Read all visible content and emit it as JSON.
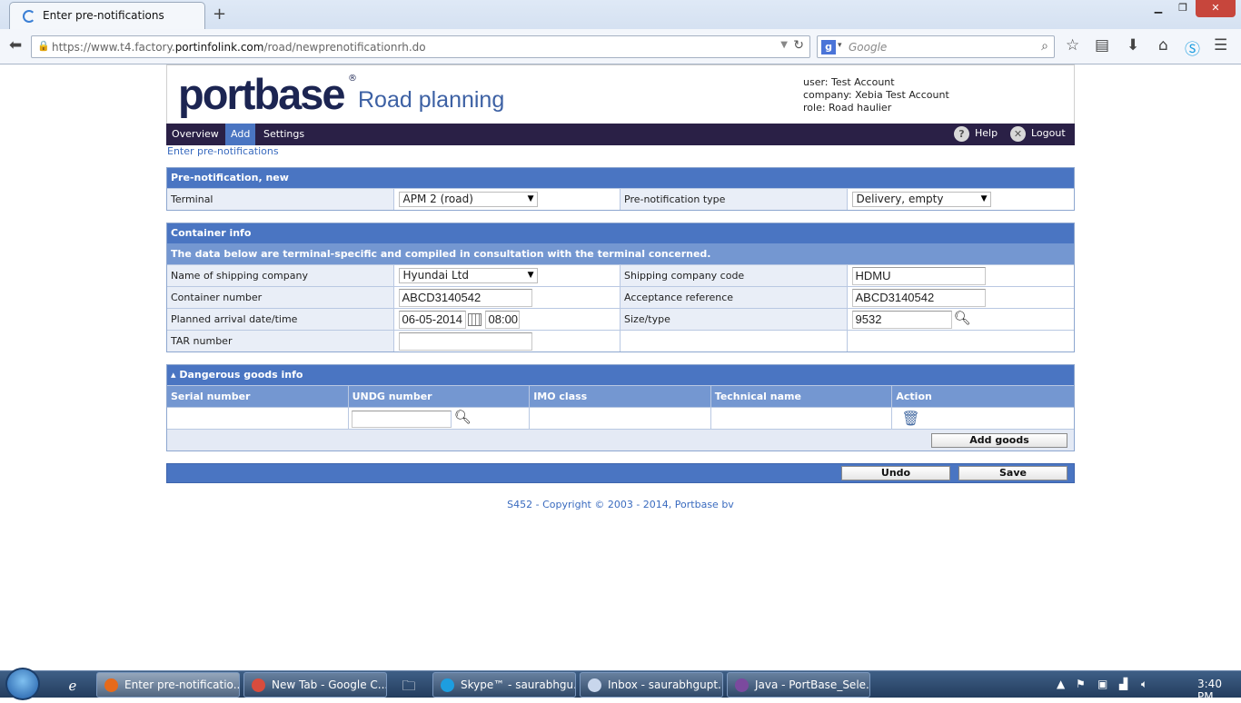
{
  "browser": {
    "tab_title": "Enter pre-notifications",
    "new_tab": "+",
    "url_prefix": "https://www.t4.factory.",
    "url_domain": "portinfolink.com",
    "url_path": "/road/newprenotificationrh.do",
    "search_placeholder": "Google",
    "window_min": "▁",
    "window_max": "❐",
    "window_close": "✕"
  },
  "header": {
    "logo": "portbase",
    "logo_mark": "®",
    "subtitle": "Road planning",
    "user_line": "user: Test Account",
    "company_line": "company: Xebia Test Account",
    "role_line": "role: Road haulier"
  },
  "menu": {
    "items": [
      {
        "label": "Overview",
        "active": false
      },
      {
        "label": "Add",
        "active": true
      },
      {
        "label": "Settings",
        "active": false
      }
    ],
    "help": "Help",
    "logout": "Logout"
  },
  "breadcrumb": "Enter pre-notifications",
  "prenotification": {
    "title": "Pre-notification, new",
    "terminal_label": "Terminal",
    "terminal_value": "APM 2 (road)",
    "type_label": "Pre-notification type",
    "type_value": "Delivery, empty"
  },
  "container": {
    "title": "Container info",
    "note": "The data below are terminal-specific and compiled in consultation with the terminal concerned.",
    "shipping_company_label": "Name of shipping company",
    "shipping_company_value": "Hyundai Ltd",
    "shipping_code_label": "Shipping company code",
    "shipping_code_value": "HDMU",
    "container_number_label": "Container number",
    "container_number_value": "ABCD3140542",
    "acceptance_label": "Acceptance reference",
    "acceptance_value": "ABCD3140542",
    "arrival_label": "Planned arrival date/time",
    "arrival_date": "06-05-2014",
    "arrival_time": "08:00",
    "size_label": "Size/type",
    "size_value": "9532",
    "tar_label": "TAR number",
    "tar_value": ""
  },
  "dangerous_goods": {
    "title": "Dangerous goods info",
    "columns": [
      "Serial number",
      "UNDG number",
      "IMO class",
      "Technical name",
      "Action"
    ],
    "undg_value": "",
    "add_button": "Add goods"
  },
  "actions": {
    "undo": "Undo",
    "save": "Save"
  },
  "footer": "S452 - Copyright © 2003 - 2014, Portbase bv",
  "taskbar": {
    "tasks": [
      {
        "label": "Enter pre-notificatio...",
        "active": true
      },
      {
        "label": "New Tab - Google C...",
        "active": false
      },
      {
        "label": "Skype™ - saurabhgu...",
        "active": false
      },
      {
        "label": "Inbox - saurabhgupt...",
        "active": false
      },
      {
        "label": "Java - PortBase_Sele...",
        "active": false
      }
    ],
    "clock": "3:40 PM"
  }
}
